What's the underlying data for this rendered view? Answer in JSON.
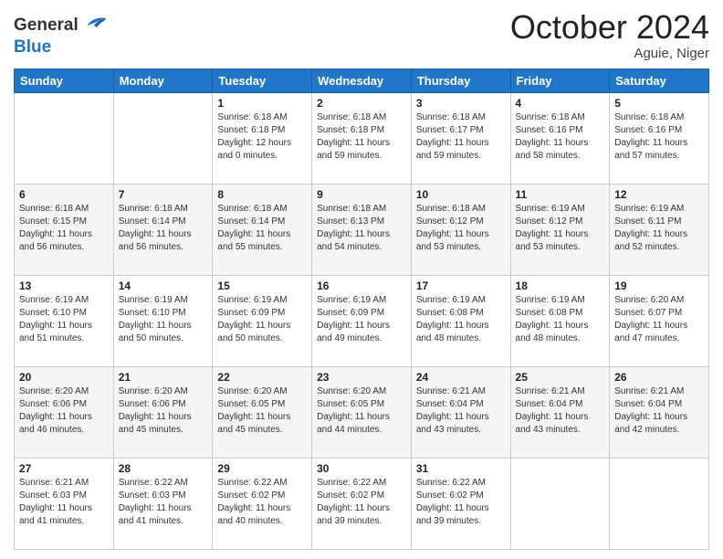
{
  "header": {
    "logo_line1": "General",
    "logo_line2": "Blue",
    "month_title": "October 2024",
    "location": "Aguie, Niger"
  },
  "weekdays": [
    "Sunday",
    "Monday",
    "Tuesday",
    "Wednesday",
    "Thursday",
    "Friday",
    "Saturday"
  ],
  "weeks": [
    [
      {
        "day": "",
        "info": ""
      },
      {
        "day": "",
        "info": ""
      },
      {
        "day": "1",
        "info": "Sunrise: 6:18 AM\nSunset: 6:18 PM\nDaylight: 12 hours\nand 0 minutes."
      },
      {
        "day": "2",
        "info": "Sunrise: 6:18 AM\nSunset: 6:18 PM\nDaylight: 11 hours\nand 59 minutes."
      },
      {
        "day": "3",
        "info": "Sunrise: 6:18 AM\nSunset: 6:17 PM\nDaylight: 11 hours\nand 59 minutes."
      },
      {
        "day": "4",
        "info": "Sunrise: 6:18 AM\nSunset: 6:16 PM\nDaylight: 11 hours\nand 58 minutes."
      },
      {
        "day": "5",
        "info": "Sunrise: 6:18 AM\nSunset: 6:16 PM\nDaylight: 11 hours\nand 57 minutes."
      }
    ],
    [
      {
        "day": "6",
        "info": "Sunrise: 6:18 AM\nSunset: 6:15 PM\nDaylight: 11 hours\nand 56 minutes."
      },
      {
        "day": "7",
        "info": "Sunrise: 6:18 AM\nSunset: 6:14 PM\nDaylight: 11 hours\nand 56 minutes."
      },
      {
        "day": "8",
        "info": "Sunrise: 6:18 AM\nSunset: 6:14 PM\nDaylight: 11 hours\nand 55 minutes."
      },
      {
        "day": "9",
        "info": "Sunrise: 6:18 AM\nSunset: 6:13 PM\nDaylight: 11 hours\nand 54 minutes."
      },
      {
        "day": "10",
        "info": "Sunrise: 6:18 AM\nSunset: 6:12 PM\nDaylight: 11 hours\nand 53 minutes."
      },
      {
        "day": "11",
        "info": "Sunrise: 6:19 AM\nSunset: 6:12 PM\nDaylight: 11 hours\nand 53 minutes."
      },
      {
        "day": "12",
        "info": "Sunrise: 6:19 AM\nSunset: 6:11 PM\nDaylight: 11 hours\nand 52 minutes."
      }
    ],
    [
      {
        "day": "13",
        "info": "Sunrise: 6:19 AM\nSunset: 6:10 PM\nDaylight: 11 hours\nand 51 minutes."
      },
      {
        "day": "14",
        "info": "Sunrise: 6:19 AM\nSunset: 6:10 PM\nDaylight: 11 hours\nand 50 minutes."
      },
      {
        "day": "15",
        "info": "Sunrise: 6:19 AM\nSunset: 6:09 PM\nDaylight: 11 hours\nand 50 minutes."
      },
      {
        "day": "16",
        "info": "Sunrise: 6:19 AM\nSunset: 6:09 PM\nDaylight: 11 hours\nand 49 minutes."
      },
      {
        "day": "17",
        "info": "Sunrise: 6:19 AM\nSunset: 6:08 PM\nDaylight: 11 hours\nand 48 minutes."
      },
      {
        "day": "18",
        "info": "Sunrise: 6:19 AM\nSunset: 6:08 PM\nDaylight: 11 hours\nand 48 minutes."
      },
      {
        "day": "19",
        "info": "Sunrise: 6:20 AM\nSunset: 6:07 PM\nDaylight: 11 hours\nand 47 minutes."
      }
    ],
    [
      {
        "day": "20",
        "info": "Sunrise: 6:20 AM\nSunset: 6:06 PM\nDaylight: 11 hours\nand 46 minutes."
      },
      {
        "day": "21",
        "info": "Sunrise: 6:20 AM\nSunset: 6:06 PM\nDaylight: 11 hours\nand 45 minutes."
      },
      {
        "day": "22",
        "info": "Sunrise: 6:20 AM\nSunset: 6:05 PM\nDaylight: 11 hours\nand 45 minutes."
      },
      {
        "day": "23",
        "info": "Sunrise: 6:20 AM\nSunset: 6:05 PM\nDaylight: 11 hours\nand 44 minutes."
      },
      {
        "day": "24",
        "info": "Sunrise: 6:21 AM\nSunset: 6:04 PM\nDaylight: 11 hours\nand 43 minutes."
      },
      {
        "day": "25",
        "info": "Sunrise: 6:21 AM\nSunset: 6:04 PM\nDaylight: 11 hours\nand 43 minutes."
      },
      {
        "day": "26",
        "info": "Sunrise: 6:21 AM\nSunset: 6:04 PM\nDaylight: 11 hours\nand 42 minutes."
      }
    ],
    [
      {
        "day": "27",
        "info": "Sunrise: 6:21 AM\nSunset: 6:03 PM\nDaylight: 11 hours\nand 41 minutes."
      },
      {
        "day": "28",
        "info": "Sunrise: 6:22 AM\nSunset: 6:03 PM\nDaylight: 11 hours\nand 41 minutes."
      },
      {
        "day": "29",
        "info": "Sunrise: 6:22 AM\nSunset: 6:02 PM\nDaylight: 11 hours\nand 40 minutes."
      },
      {
        "day": "30",
        "info": "Sunrise: 6:22 AM\nSunset: 6:02 PM\nDaylight: 11 hours\nand 39 minutes."
      },
      {
        "day": "31",
        "info": "Sunrise: 6:22 AM\nSunset: 6:02 PM\nDaylight: 11 hours\nand 39 minutes."
      },
      {
        "day": "",
        "info": ""
      },
      {
        "day": "",
        "info": ""
      }
    ]
  ]
}
